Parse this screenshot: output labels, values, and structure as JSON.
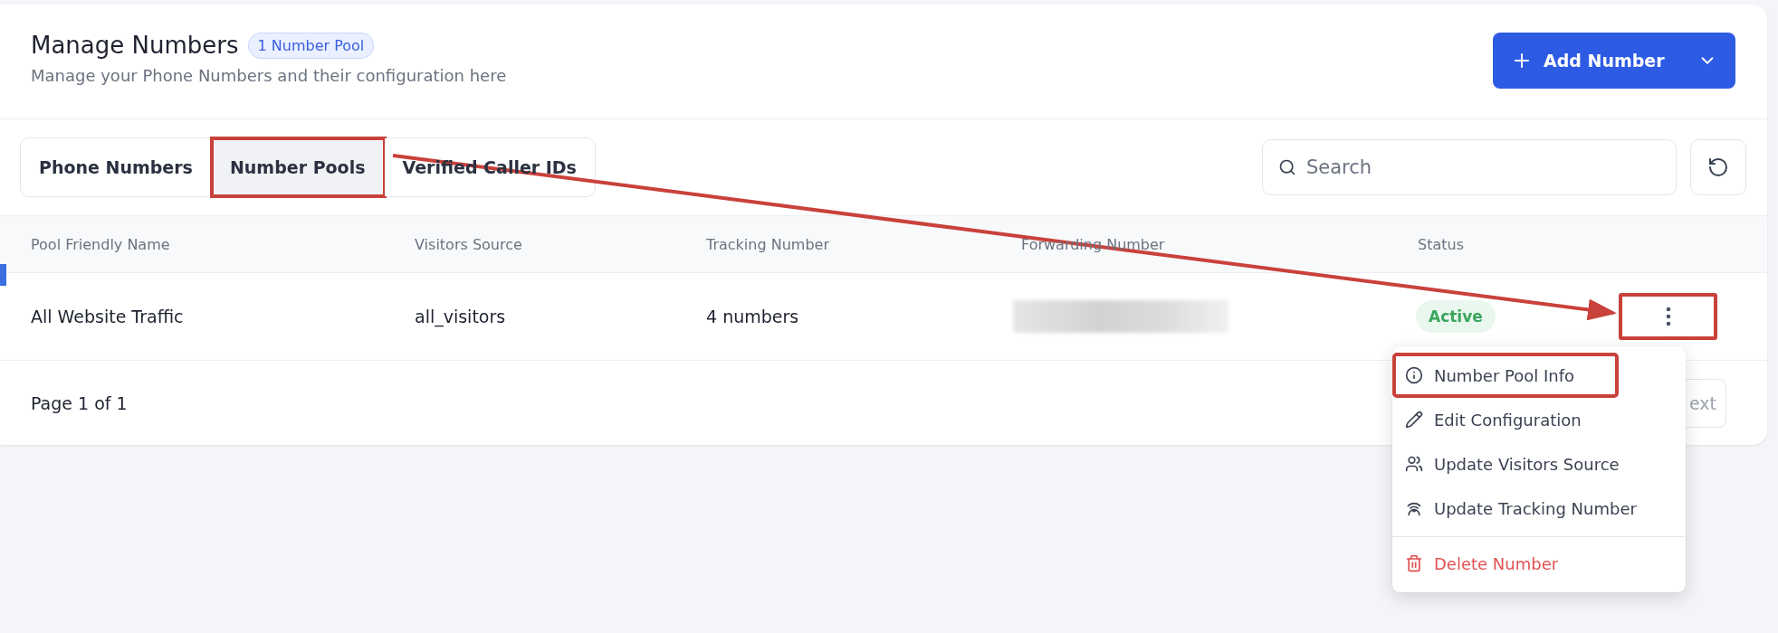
{
  "header": {
    "title": "Manage Numbers",
    "badge": "1 Number Pool",
    "subtitle": "Manage your Phone Numbers and their configuration here",
    "add_button": "Add Number"
  },
  "tabs": [
    {
      "label": "Phone Numbers",
      "selected": false,
      "highlighted": false
    },
    {
      "label": "Number Pools",
      "selected": true,
      "highlighted": true
    },
    {
      "label": "Verified Caller IDs",
      "selected": false,
      "highlighted": false
    }
  ],
  "search": {
    "placeholder": "Search"
  },
  "table": {
    "columns": [
      "Pool Friendly Name",
      "Visitors Source",
      "Tracking Number",
      "Forwarding Number",
      "Status"
    ],
    "rows": [
      {
        "name": "All Website Traffic",
        "source": "all_visitors",
        "tracking": "4 numbers",
        "forwarding_redacted": true,
        "status": "Active",
        "actions_highlighted": true
      }
    ]
  },
  "pagination": {
    "label": "Page 1 of 1",
    "next": "ext"
  },
  "row_menu": {
    "items": [
      {
        "kind": "info",
        "label": "Number Pool Info",
        "highlighted": true
      },
      {
        "kind": "edit",
        "label": "Edit Configuration",
        "highlighted": false
      },
      {
        "kind": "visitors",
        "label": "Update Visitors Source",
        "highlighted": false
      },
      {
        "kind": "tracking",
        "label": "Update Tracking Number",
        "highlighted": false
      },
      {
        "kind": "delete",
        "label": "Delete Number",
        "highlighted": false
      }
    ]
  }
}
